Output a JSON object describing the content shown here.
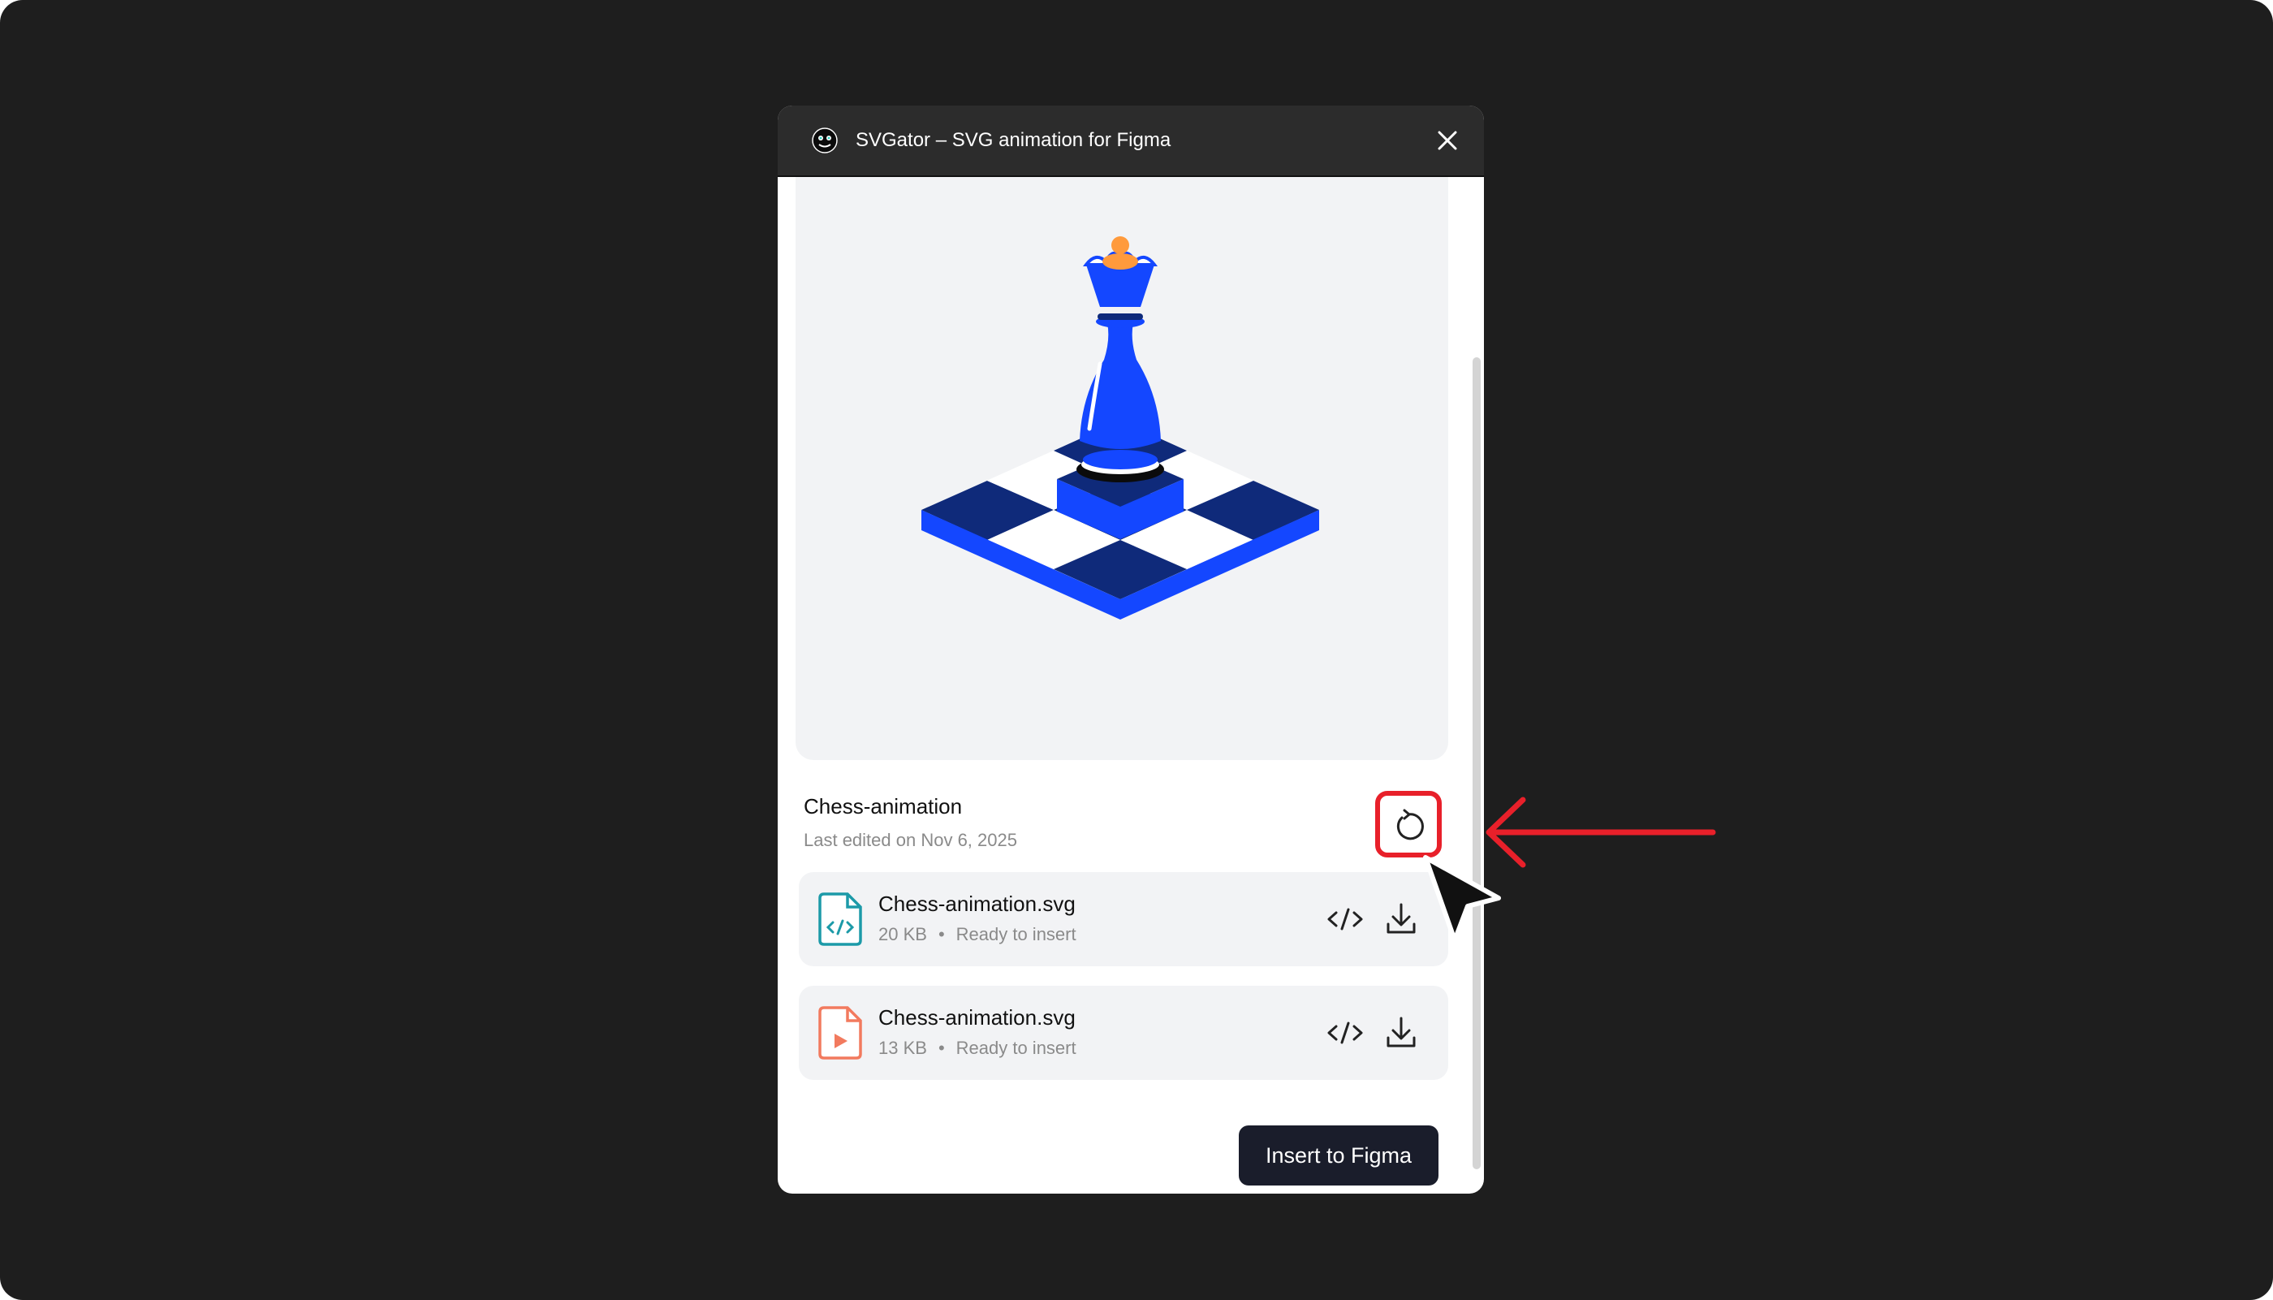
{
  "window": {
    "title": "SVGator – SVG animation for Figma",
    "logo_icon": "svgator-logo-icon",
    "close_icon": "close-icon"
  },
  "project": {
    "name": "Chess-animation",
    "last_edited": "Last edited on Nov 6, 2025",
    "refresh_icon": "refresh-icon"
  },
  "files": [
    {
      "name": "Chess-animation.svg",
      "size": "20 KB",
      "separator": "•",
      "status": "Ready to insert",
      "icon": "svg-code-file-icon",
      "icon_color": "#1c9aa8"
    },
    {
      "name": "Chess-animation.svg",
      "size": "13 KB",
      "separator": "•",
      "status": "Ready to insert",
      "icon": "animated-svg-file-icon",
      "icon_color": "#f27a5e"
    }
  ],
  "actions": {
    "insert_label": "Insert to Figma"
  },
  "colors": {
    "background": "#1e1e1e",
    "titlebar": "#2c2c2c",
    "preview_bg": "#f2f3f5",
    "accent_blue": "#1447ff",
    "dark_blue": "#0f2a7a",
    "accent_orange": "#ff9a3c",
    "highlight_red": "#e8202a",
    "button_dark": "#1a1d2b"
  }
}
